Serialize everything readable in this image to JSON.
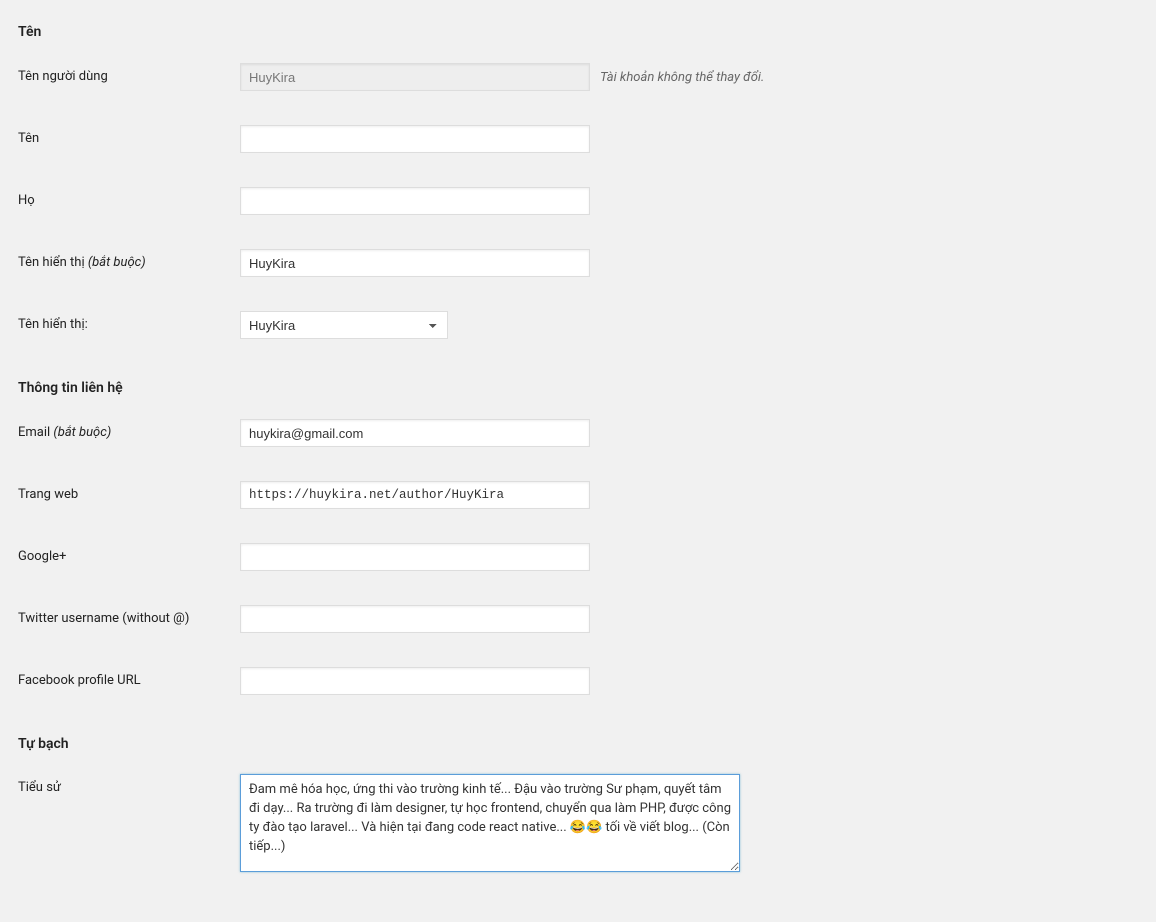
{
  "sections": {
    "name_heading": "Tên",
    "contact_heading": "Thông tin liên hệ",
    "about_heading": "Tự bạch"
  },
  "labels": {
    "username": "Tên người dùng",
    "first_name": "Tên",
    "last_name": "Họ",
    "display_name_required_prefix": "Tên hiển thị ",
    "display_name_required_suffix": "(bắt buộc)",
    "display_name_select": "Tên hiển thị:",
    "email_prefix": "Email ",
    "email_suffix": "(bắt buộc)",
    "website": "Trang web",
    "googleplus": "Google+",
    "twitter": "Twitter username (without @)",
    "facebook": "Facebook profile URL",
    "bio": "Tiểu sử"
  },
  "values": {
    "username": "HuyKira",
    "first_name": "",
    "last_name": "",
    "display_name": "HuyKira",
    "display_name_selected": "HuyKira",
    "email": "huykira@gmail.com",
    "website": "https://huykira.net/author/HuyKira",
    "googleplus": "",
    "twitter": "",
    "facebook": "",
    "bio": "Đam mê hóa học, ứng thi vào trường kinh tế... Đậu vào trường Sư phạm, quyết tâm đi dạy... Ra trường đi làm designer, tự học frontend, chuyển qua làm PHP, được công ty đào tạo laravel... Và hiện tại đang code react native... 😂😂 tối về viết blog... (Còn tiếp...)"
  },
  "hints": {
    "username": "Tài khoản không thể thay đổi."
  }
}
